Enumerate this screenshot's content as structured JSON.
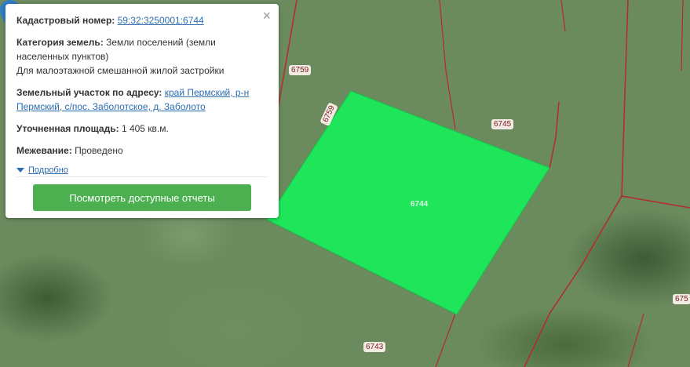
{
  "popup": {
    "cadastral_label": "Кадастровый номер:",
    "cadastral_value": "59:32:3250001:6744",
    "category_label": "Категория земель:",
    "category_value_1": "Земли поселений (земли",
    "category_value_2": "населенных пунктов)",
    "category_value_3": "Для малоэтажной смешанной жилой застройки",
    "address_label": "Земельный участок по адресу:",
    "address_value_1": "край Пермский, р-н",
    "address_value_2": "Пермский, с/пос. Заболотское, д. Заболото",
    "area_label": "Уточненная площадь:",
    "area_value": "1 405 кв.м.",
    "survey_label": "Межевание:",
    "survey_value": "Проведено",
    "more_label": "Подробно",
    "reports_button": "Посмотреть доступные отчеты",
    "close_glyph": "×"
  },
  "map": {
    "parcel_labels": [
      "6759",
      "6759",
      "6745",
      "6743",
      "675",
      "6744"
    ],
    "parcel_fill_color": "#1ee55a",
    "boundary_color": "#b62a2a",
    "marker_color": "#2f7dc4"
  }
}
